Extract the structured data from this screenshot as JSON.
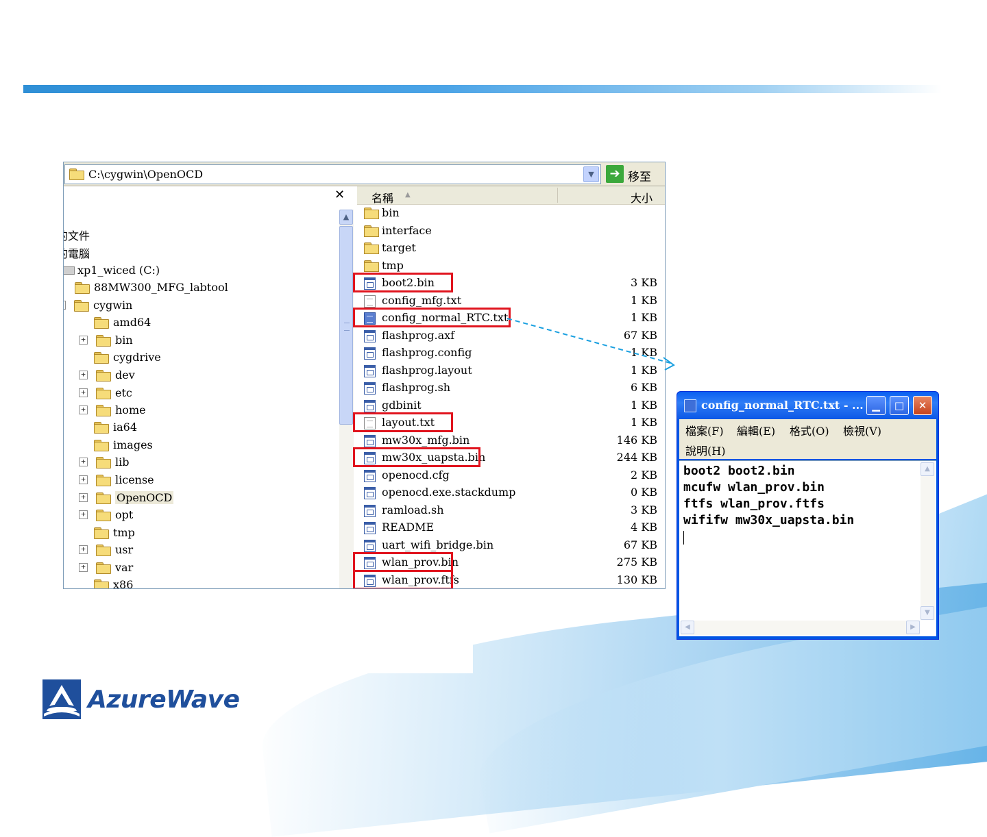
{
  "explorer": {
    "address": "C:\\cygwin\\OpenOCD",
    "go_label": "移至",
    "close_label": "✕",
    "columns": {
      "name": "名稱",
      "size": "大小"
    },
    "tree": [
      {
        "label": "我的文件",
        "visible": "的文件"
      },
      {
        "label": "我的電腦",
        "visible": "的電腦"
      },
      {
        "label": "xp1_wiced (C:)"
      },
      {
        "label": "88MW300_MFG_labtool"
      },
      {
        "label": "cygwin"
      },
      {
        "label": "amd64"
      },
      {
        "label": "bin"
      },
      {
        "label": "cygdrive"
      },
      {
        "label": "dev"
      },
      {
        "label": "etc"
      },
      {
        "label": "home"
      },
      {
        "label": "ia64"
      },
      {
        "label": "images"
      },
      {
        "label": "lib"
      },
      {
        "label": "license"
      },
      {
        "label": "OpenOCD"
      },
      {
        "label": "opt"
      },
      {
        "label": "tmp"
      },
      {
        "label": "usr"
      },
      {
        "label": "var"
      },
      {
        "label": "x86"
      }
    ],
    "files": [
      {
        "name": "bin",
        "size": "",
        "icon": "folder-icon"
      },
      {
        "name": "interface",
        "size": "",
        "icon": "folder-icon"
      },
      {
        "name": "target",
        "size": "",
        "icon": "folder-icon"
      },
      {
        "name": "tmp",
        "size": "",
        "icon": "folder-icon"
      },
      {
        "name": "boot2.bin",
        "size": "3 KB",
        "icon": "binary-file-icon",
        "highlighted": true
      },
      {
        "name": "config_mfg.txt",
        "size": "1 KB",
        "icon": "text-file-icon"
      },
      {
        "name": "config_normal_RTC.txt",
        "size": "1 KB",
        "icon": "text-file-icon",
        "highlighted": true
      },
      {
        "name": "flashprog.axf",
        "size": "67 KB",
        "icon": "binary-file-icon"
      },
      {
        "name": "flashprog.config",
        "size": "1 KB",
        "icon": "binary-file-icon"
      },
      {
        "name": "flashprog.layout",
        "size": "1 KB",
        "icon": "binary-file-icon"
      },
      {
        "name": "flashprog.sh",
        "size": "6 KB",
        "icon": "binary-file-icon"
      },
      {
        "name": "gdbinit",
        "size": "1 KB",
        "icon": "binary-file-icon"
      },
      {
        "name": "layout.txt",
        "size": "1 KB",
        "icon": "text-file-icon",
        "highlighted": true
      },
      {
        "name": "mw30x_mfg.bin",
        "size": "146 KB",
        "icon": "binary-file-icon"
      },
      {
        "name": "mw30x_uapsta.bin",
        "size": "244 KB",
        "icon": "binary-file-icon",
        "highlighted": true
      },
      {
        "name": "openocd.cfg",
        "size": "2 KB",
        "icon": "binary-file-icon"
      },
      {
        "name": "openocd.exe.stackdump",
        "size": "0 KB",
        "icon": "binary-file-icon"
      },
      {
        "name": "ramload.sh",
        "size": "3 KB",
        "icon": "binary-file-icon"
      },
      {
        "name": "README",
        "size": "4 KB",
        "icon": "binary-file-icon"
      },
      {
        "name": "uart_wifi_bridge.bin",
        "size": "67 KB",
        "icon": "binary-file-icon"
      },
      {
        "name": "wlan_prov.bin",
        "size": "275 KB",
        "icon": "binary-file-icon",
        "highlighted": true
      },
      {
        "name": "wlan_prov.ftfs",
        "size": "130 KB",
        "icon": "binary-file-icon",
        "highlighted": true
      }
    ]
  },
  "notepad": {
    "title": "config_normal_RTC.txt - ...",
    "menu": [
      "檔案(F)",
      "編輯(E)",
      "格式(O)",
      "檢視(V)",
      "說明(H)"
    ],
    "lines": [
      "boot2 boot2.bin",
      "mcufw wlan_prov.bin",
      "ftfs wlan_prov.ftfs",
      "wififw mw30x_uapsta.bin"
    ]
  },
  "logo": {
    "text": "AzureWave"
  },
  "colors": {
    "highlight": "#e0141e",
    "arrow": "#1aa0e0",
    "brand": "#1f4f9c"
  }
}
